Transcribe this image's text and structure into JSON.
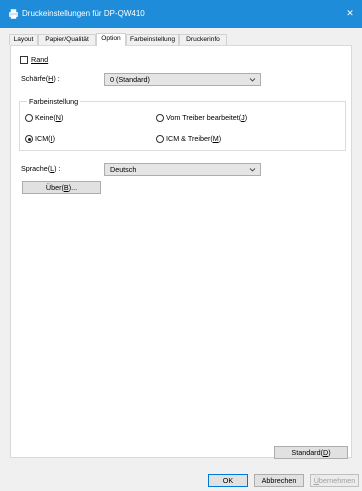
{
  "window": {
    "title": "Druckeinstellungen für DP-QW410",
    "close_glyph": "✕",
    "icon": "printer-icon"
  },
  "tabs": [
    {
      "label": "Layout"
    },
    {
      "label": "Papier/Qualität"
    },
    {
      "label": "Option"
    },
    {
      "label": "Farbeinstellung"
    },
    {
      "label": "Druckerinfo"
    }
  ],
  "active_tab": "Option",
  "option": {
    "rand": {
      "label": "Rand",
      "checked": false
    },
    "schaerfe": {
      "label_pre": "Schärfe(",
      "label_key": "H",
      "label_post": ") :",
      "value": "0 (Standard)"
    },
    "farbeinstellung": {
      "group_title": "Farbeinstellung",
      "options": [
        {
          "pre": "Keine(",
          "key": "N",
          "post": ")",
          "checked": false
        },
        {
          "pre": "Vom Treiber bearbeitet(",
          "key": "J",
          "post": ")",
          "checked": false
        },
        {
          "pre": "ICM(",
          "key": "I",
          "post": ")",
          "checked": true
        },
        {
          "pre": "ICM & Treiber(",
          "key": "M",
          "post": ")",
          "checked": false
        }
      ]
    },
    "sprache": {
      "label_pre": "Sprache(",
      "label_key": "L",
      "label_post": ") :",
      "value": "Deutsch"
    },
    "about_button": {
      "pre": "Über(",
      "key": "B",
      "post": ")..."
    },
    "standard_button": {
      "pre": "Standard(",
      "key": "D",
      "post": ")"
    }
  },
  "footer": {
    "ok": "OK",
    "cancel": "Abbrechen",
    "apply_key": "Ü",
    "apply_rest": "bernehmen"
  },
  "colors": {
    "titlebar": "#1e8cd8",
    "dialog_bg": "#f0f0f0",
    "primary_border": "#0078d7"
  }
}
